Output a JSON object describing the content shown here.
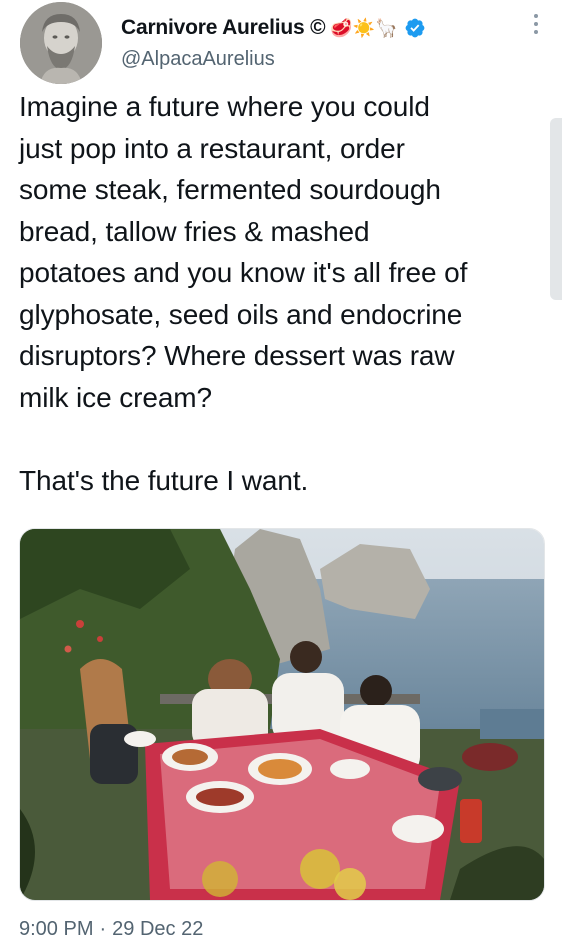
{
  "author": {
    "display_name": "Carnivore Aurelius ©",
    "emojis": "🥩☀️🦙",
    "handle": "@AlpacaAurelius",
    "verified": true
  },
  "tweet": {
    "text": "Imagine a future where you could\njust pop into a restaurant, order\nsome steak, fermented sourdough\nbread, tallow fries & mashed\npotatoes and you know it's all free of\nglyphosate, seed oils and endocrine\ndisruptors? Where dessert was raw\nmilk ice cream?\n\nThat's the future I want.",
    "time": "9:00 PM",
    "separator": "·",
    "date": "29 Dec 22"
  },
  "icons": {
    "verified": "verified-badge-icon",
    "more": "more-options-icon",
    "avatar": "marcus-aurelius-bust-avatar"
  },
  "colors": {
    "text": "#0f1419",
    "secondary": "#536471",
    "verified": "#1d9bf0"
  }
}
